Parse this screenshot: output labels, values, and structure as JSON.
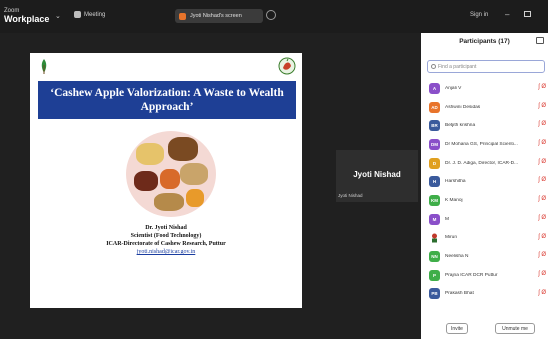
{
  "app": {
    "brand_line1": "Zoom",
    "brand_line2": "Workplace",
    "meeting_label": "Meeting",
    "share_banner": "Jyoti Nishad's screen",
    "sign_in": "Sign in",
    "minimize": "–"
  },
  "slide": {
    "title": "‘Cashew Apple Valorization: A Waste to Wealth Approach’",
    "presenter": "Dr. Jyoti Nishad",
    "role": "Scientist (Food Technology)",
    "org": "ICAR-Directorate of Cashew Research, Puttur",
    "email": "jyoti.nishad@icar.gov.in"
  },
  "speaker": {
    "name": "Jyoti Nishad",
    "tag": "Jyoti Nishad"
  },
  "participants": {
    "header": "Participants (17)",
    "search_placeholder": "Find a participant",
    "invite_label": "Invite",
    "unmute_label": "Unmute me",
    "mic_glyph": "ʃ Ø",
    "items": [
      {
        "initials": "A",
        "name": "Anjali V",
        "color": "#8a4fc9"
      },
      {
        "initials": "AD",
        "name": "Ashwini Desidas",
        "color": "#e8742b"
      },
      {
        "initials": "BR",
        "name": "Betjith krishna",
        "color": "#3a5a9c"
      },
      {
        "initials": "DM",
        "name": "Dr Mohana GS, Principal Scienti...",
        "color": "#8a4fc9"
      },
      {
        "initials": "D",
        "name": "Dr. J. D. Adiga, Director, ICAR-D...",
        "color": "#e0a020"
      },
      {
        "initials": "H",
        "name": "Harshitha",
        "color": "#3a5a9c"
      },
      {
        "initials": "KM",
        "name": "K Manoj",
        "color": "#3fae49"
      },
      {
        "initials": "M",
        "name": "M",
        "color": "#8a4fc9"
      },
      {
        "initials": "",
        "name": "Mirun",
        "color": "#ffffff"
      },
      {
        "initials": "NN",
        "name": "Neelisha N",
        "color": "#3fae49"
      },
      {
        "initials": "P",
        "name": "Prajna ICAR DCR Puttur",
        "color": "#3fae49"
      },
      {
        "initials": "PB",
        "name": "Prakash Bhat",
        "color": "#3a5a9c"
      }
    ]
  }
}
